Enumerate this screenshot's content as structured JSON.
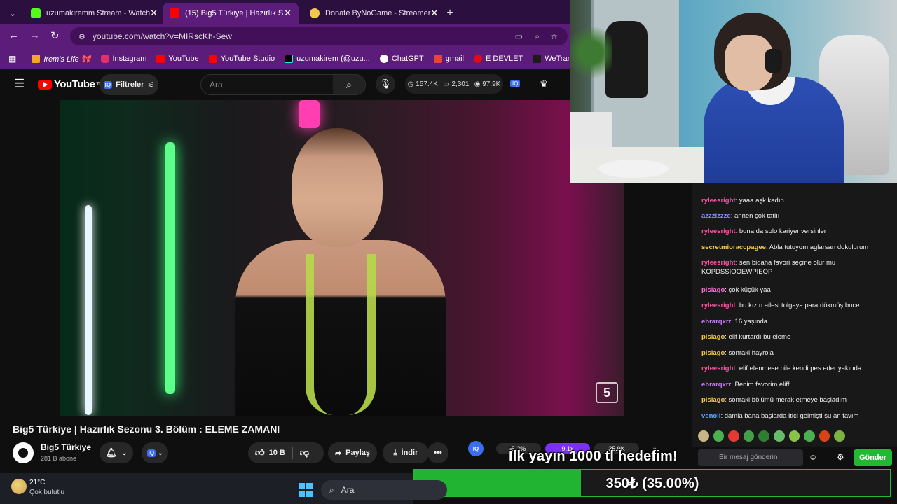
{
  "browser": {
    "tabs": [
      {
        "title": "uzumakiremm Stream - Watch",
        "favicon_color": "#53fc18",
        "active": false
      },
      {
        "title": "(15) Big5 Türkiye | Hazırlık S",
        "favicon_color": "#ff0000",
        "active": true
      },
      {
        "title": "Donate ByNoGame - Streamer",
        "favicon_color": "#f2c94c",
        "active": false
      }
    ],
    "url": "youtube.com/watch?v=MIRscKh-Sew",
    "bookmarks": [
      {
        "label": "Irem's Life 🎀",
        "color": "#f5a623"
      },
      {
        "label": "Instagram",
        "color": "#e1306c"
      },
      {
        "label": "YouTube",
        "color": "#ff0000"
      },
      {
        "label": "YouTube Studio",
        "color": "#ff0000"
      },
      {
        "label": "uzumakirem (@uzu...",
        "color": "#000000"
      },
      {
        "label": "ChatGPT",
        "color": "#ffffff"
      },
      {
        "label": "gmail",
        "color": "#ea4335"
      },
      {
        "label": "E DEVLET",
        "color": "#e30a17"
      },
      {
        "label": "WeTransfer",
        "color": "#1b1b1b"
      }
    ]
  },
  "youtube": {
    "logo": "YouTube",
    "logo_sup": "TR",
    "filter_label": "Filtreler",
    "search_placeholder": "Ara",
    "stats": {
      "views": "157.4K",
      "comments": "2,301",
      "likes_stat": "97.9K"
    },
    "video_title": "Big5 Türkiye | Hazırlık Sezonu 3. Bölüm : ELEME ZAMANI",
    "channel_name": "Big5 Türkiye",
    "subscribers": "281 B abone",
    "likes": "10 B",
    "share_label": "Paylaş",
    "download_label": "İndir",
    "watermark": "5",
    "speed_stats": {
      "a": "5.2%",
      "b": "9.1x",
      "c": "35.9K"
    }
  },
  "chat": {
    "messages": [
      {
        "user": "rylеesright",
        "color": "#ff4fa0",
        "text": "yaaa aşk kadın"
      },
      {
        "user": "azzzizzze",
        "color": "#8a8cff",
        "text": "annen çok tatlıı"
      },
      {
        "user": "ryleesright",
        "color": "#ff4fa0",
        "text": "buna da solo kariyer versinler"
      },
      {
        "user": "secretmioraccpagee",
        "color": "#f2c94c",
        "text": "Abla tutuyom aglarsan dokulurum"
      },
      {
        "user": "ryleesright",
        "color": "#ff4fa0",
        "text": "sen bidaha favori seçme olur mu KOPDSSIOOEWPIEOP"
      },
      {
        "user": "pisiago",
        "color": "#ff6bd6",
        "text": "çok küçük yaa"
      },
      {
        "user": "ryleesright",
        "color": "#ff4fa0",
        "text": "bu kızın ailesi tolgaya para dökmüş bnce"
      },
      {
        "user": "ebrarqxrr",
        "color": "#c77dff",
        "text": "16 yaşında"
      },
      {
        "user": "pisiago",
        "color": "#f2c94c",
        "text": "elif kurtardı bu eleme"
      },
      {
        "user": "pisiago",
        "color": "#f2c94c",
        "text": "sonraki hayrola"
      },
      {
        "user": "ryleesright",
        "color": "#ff4fa0",
        "text": "elif elenmese bile kendi pes eder yakında"
      },
      {
        "user": "ebrarqxrr",
        "color": "#c77dff",
        "text": "Benim favorim eliff"
      },
      {
        "user": "pisiago",
        "color": "#f2c94c",
        "text": "sonraki bölümü merak etmeye başladım"
      },
      {
        "user": "venoli",
        "color": "#5aa9ff",
        "text": "damla bana başlarda itici gelmişti şu an favım"
      }
    ],
    "input_placeholder": "Bir mesaj gönderin",
    "send_label": "Gönder"
  },
  "overlay": {
    "goal_text": "İlk yayın 1000 tl hedefim!",
    "goal_amount": "350₺ (35.00%)",
    "goal_percent": 35
  },
  "taskbar": {
    "temperature": "21°C",
    "weather": "Çok bulutlu",
    "search_placeholder": "Ara"
  }
}
